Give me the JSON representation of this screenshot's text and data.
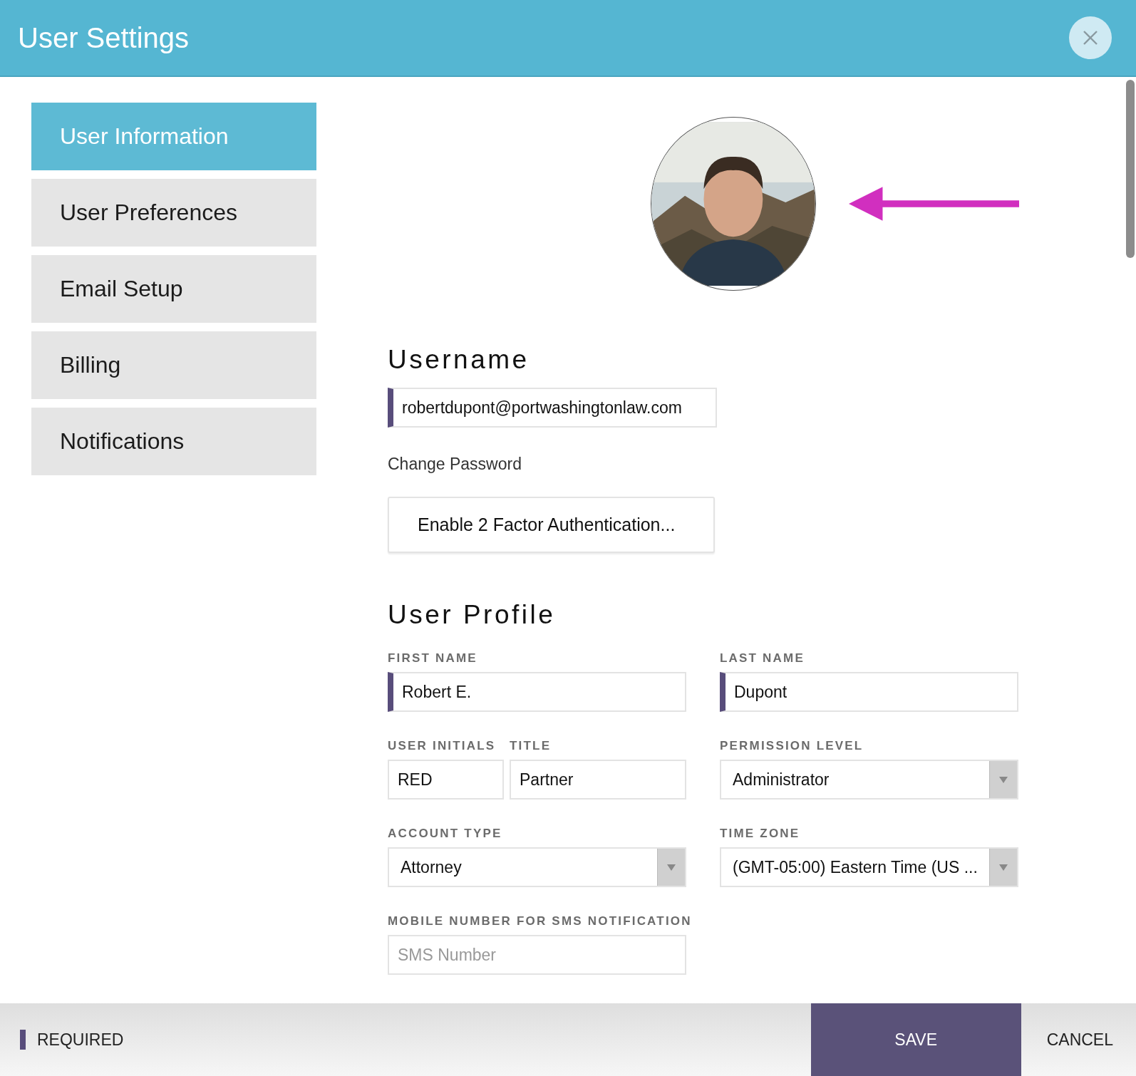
{
  "window": {
    "title": "User Settings"
  },
  "sidebar": {
    "items": [
      {
        "label": "User Information",
        "selected": true
      },
      {
        "label": "User Preferences",
        "selected": false
      },
      {
        "label": "Email Setup",
        "selected": false
      },
      {
        "label": "Billing",
        "selected": false
      },
      {
        "label": "Notifications",
        "selected": false
      }
    ]
  },
  "username": {
    "heading": "Username",
    "value": "robertdupont@portwashingtonlaw.com",
    "required": true
  },
  "change_password": "Change Password",
  "two_factor_button": "Enable 2 Factor Authentication...",
  "profile": {
    "heading": "User Profile",
    "fields": [
      {
        "label": "FIRST NAME",
        "kind": "text",
        "value": "Robert E.",
        "required": true
      },
      {
        "label": "LAST NAME",
        "kind": "text",
        "value": "Dupont",
        "required": true
      },
      {
        "label": "USER INITIALS",
        "kind": "text",
        "value": "RED",
        "required": false
      },
      {
        "label": "TITLE",
        "kind": "text",
        "value": "Partner",
        "required": false
      },
      {
        "label": "PERMISSION LEVEL",
        "kind": "select",
        "value": "Administrator"
      },
      {
        "label": "ACCOUNT TYPE",
        "kind": "select",
        "value": "Attorney"
      },
      {
        "label": "TIME ZONE",
        "kind": "select",
        "value": "(GMT-05:00) Eastern Time (US ..."
      },
      {
        "label": "MOBILE NUMBER FOR SMS NOTIFICATION",
        "kind": "text",
        "placeholder": "SMS Number",
        "required": false
      }
    ]
  },
  "footer": {
    "required_legend": "REQUIRED",
    "buttons": [
      {
        "label": "SAVE",
        "kind": "primary"
      },
      {
        "label": "CANCEL",
        "kind": "plain"
      }
    ]
  }
}
